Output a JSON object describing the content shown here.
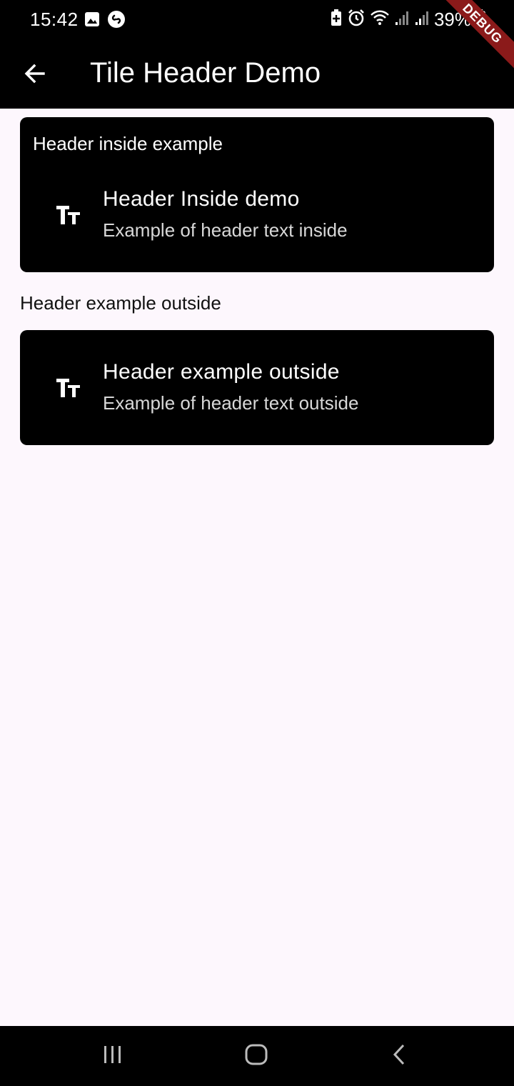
{
  "status_bar": {
    "time": "15:42",
    "battery_percent": "39%",
    "icons": [
      "image-icon",
      "shazam-icon",
      "battery-saver-icon",
      "alarm-icon",
      "wifi-icon",
      "signal-icon",
      "signal-icon",
      "battery-icon"
    ]
  },
  "app_bar": {
    "title": "Tile Header Demo",
    "back_icon": "arrow-back-icon",
    "debug_label": "DEBUG"
  },
  "cards": [
    {
      "header": "Header inside example",
      "title": "Header Inside demo",
      "subtitle": "Example of header text inside",
      "icon": "text-fields-icon"
    },
    {
      "title": "Header example outside",
      "subtitle": "Example of header text outside",
      "icon": "text-fields-icon"
    }
  ],
  "outside_header": "Header example outside",
  "nav_bar": {
    "icons": [
      "recent-apps-icon",
      "home-icon",
      "back-icon"
    ]
  },
  "colors": {
    "background": "#fdf7fd",
    "card": "#000000",
    "app_bar": "#000000",
    "debug_banner": "#8b1a1a"
  }
}
